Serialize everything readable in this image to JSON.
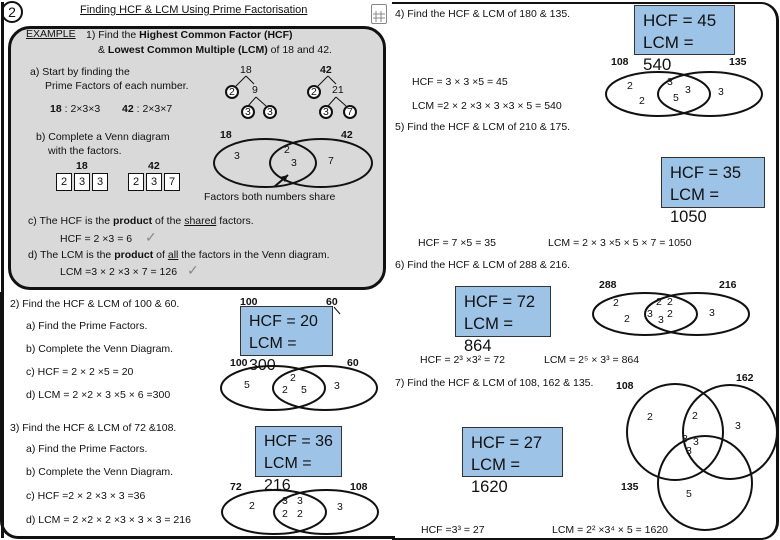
{
  "header": {
    "page_number": "2",
    "title": "Finding HCF & LCM Using Prime Factorisation",
    "calculator_icon": "calculator-icon"
  },
  "example": {
    "label": "EXAMPLE",
    "question_line1_a": "1) Find the ",
    "question_line1_b": "Highest Common Factor (HCF)",
    "question_line2_a": "& ",
    "question_line2_b": "Lowest Common Multiple (LCM)",
    "question_line2_c": " of 18 and 42.",
    "part_a_line1": "a) Start by finding the",
    "part_a_line2": "Prime Factors of each number.",
    "factor_18_label": "18",
    "factor_18_value": " : 2×3×3",
    "factor_42_label": "42",
    "factor_42_value": " : 2×3×7",
    "tree_18": {
      "root": "18",
      "prime1": "2",
      "mid": "9",
      "prime2": "3",
      "prime3": "3"
    },
    "tree_42": {
      "root": "42",
      "prime1": "2",
      "mid": "21",
      "prime2": "3",
      "prime3": "7"
    },
    "part_b_line1": "b) Complete a Venn diagram",
    "part_b_line2": "with the factors.",
    "boxes_18": {
      "label": "18",
      "values": [
        "2",
        "3",
        "3"
      ]
    },
    "boxes_42": {
      "label": "42",
      "values": [
        "2",
        "3",
        "7"
      ]
    },
    "venn": {
      "left_label": "18",
      "right_label": "42",
      "left_only": [
        "3"
      ],
      "shared": [
        "2",
        "3"
      ],
      "right_only": [
        "7"
      ]
    },
    "arrow_caption": "Factors both numbers share",
    "part_c_a": "c) The HCF is the ",
    "part_c_b": "product",
    "part_c_c": " of the ",
    "part_c_d": "shared",
    "part_c_e": " factors.",
    "hcf_calc": "HCF = 2 ×3 = 6",
    "part_d_a": "d) The LCM is the ",
    "part_d_b": "product",
    "part_d_c": " of ",
    "part_d_d": "all",
    "part_d_e": " the factors in the Venn diagram.",
    "lcm_calc": "LCM =3 × 2 ×3 × 7 = 126",
    "tick": "✓"
  },
  "q2": {
    "question": "2) Find the HCF & LCM of 100 & 60.",
    "a": "a) Find the Prime Factors.",
    "b": "b) Complete the Venn Diagram.",
    "c": "c) HCF = 2 × 2 ×5 = 20",
    "d": "d) LCM = 2 ×2 × 3 ×5 × 6 =300",
    "answer_hcf": "HCF = 20",
    "answer_lcm": "LCM = 300",
    "tree_labels": [
      "100",
      "60"
    ],
    "venn": {
      "left_label": "100",
      "right_label": "60",
      "left_only": [
        "5"
      ],
      "shared": [
        "2",
        "2",
        "5"
      ],
      "right_only": [
        "3"
      ]
    }
  },
  "q3": {
    "question": "3) Find the HCF & LCM of 72 &108.",
    "a": "a) Find the Prime Factors.",
    "b": "b) Complete the Venn Diagram.",
    "c": "c) HCF =2 × 2 ×3 × 3 =36",
    "d": "d) LCM = 2 ×2 × 2 ×3 × 3 × 3 = 216",
    "answer_hcf": "HCF = 36",
    "answer_lcm": "LCM = 216",
    "venn": {
      "left_label": "72",
      "right_label": "108",
      "left_only": [
        "2"
      ],
      "shared": [
        "3",
        "3",
        "2",
        "2"
      ],
      "right_only": [
        "3"
      ]
    }
  },
  "q4": {
    "question": "4) Find the HCF & LCM of 180 & 135.",
    "hcf_calc": "HCF = 3 × 3 ×5 = 45",
    "lcm_calc": "LCM =2 × 2 ×3 × 3 ×3 × 5 = 540",
    "answer_hcf": "HCF = 45",
    "answer_lcm": "LCM = 540",
    "venn": {
      "left_label": "108",
      "right_label": "135",
      "left_only": [
        "2",
        "2"
      ],
      "shared": [
        "3",
        "3",
        "5"
      ],
      "right_only": [
        "3"
      ]
    }
  },
  "q5": {
    "question": "5) Find the HCF & LCM of 210 & 175.",
    "hcf_calc": "HCF = 7 ×5 = 35",
    "lcm_calc": "LCM = 2 × 3 ×5 × 5 × 7 = 1050",
    "answer_hcf": "HCF = 35",
    "answer_lcm": "LCM = 1050"
  },
  "q6": {
    "question": "6) Find the HCF & LCM of 288 & 216.",
    "hcf_calc": "HCF = 2³ ×3² = 72",
    "lcm_calc": "LCM = 2⁵ × 3³ = 864",
    "answer_hcf": "HCF = 72",
    "answer_lcm": "LCM = 864",
    "venn": {
      "left_label": "288",
      "right_label": "216",
      "left_only": [
        "2",
        "2"
      ],
      "shared": [
        "2",
        "2",
        "3",
        "3",
        "2"
      ],
      "right_only": [
        "3"
      ]
    }
  },
  "q7": {
    "question": "7) Find the HCF & LCM of 108, 162 & 135.",
    "hcf_calc": "HCF =3³ = 27",
    "lcm_calc": "LCM = 2² ×3⁴ × 5 = 1620",
    "answer_hcf": "HCF = 27",
    "answer_lcm": "LCM = 1620",
    "venn": {
      "label_a": "108",
      "label_b": "162",
      "label_c": "135",
      "a_only": [
        "2"
      ],
      "ab": [
        "2"
      ],
      "b_only": [
        "3"
      ],
      "abc": [
        "3",
        "3",
        "3"
      ],
      "c_only": [
        "5"
      ]
    }
  }
}
